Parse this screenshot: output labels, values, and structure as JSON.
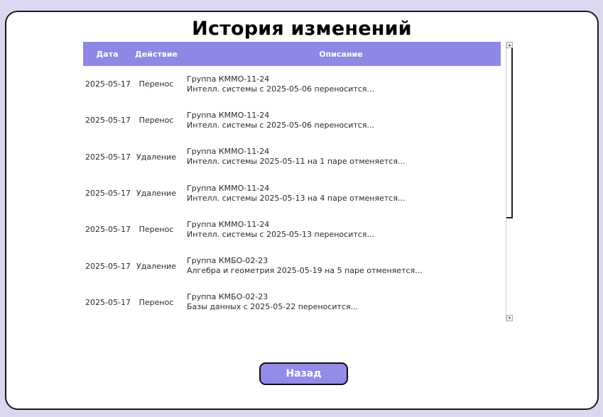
{
  "page": {
    "title": "История изменений"
  },
  "table": {
    "columns": [
      "Дата",
      "Действие",
      "Описание"
    ],
    "rows": [
      {
        "date": "2025-05-17",
        "action": "Перенос",
        "line1": "Группа КММО-11-24",
        "line2": "Интелл. системы с 2025-05-06 переносится..."
      },
      {
        "date": "2025-05-17",
        "action": "Перенос",
        "line1": "Группа КММО-11-24",
        "line2": "Интелл. системы с 2025-05-06 переносится..."
      },
      {
        "date": "2025-05-17",
        "action": "Удаление",
        "line1": "Группа КММО-11-24",
        "line2": "Интелл. системы 2025-05-11 на 1 паре отменяется..."
      },
      {
        "date": "2025-05-17",
        "action": "Удаление",
        "line1": "Группа КММО-11-24",
        "line2": "Интелл. системы 2025-05-13 на 4 паре отменяется..."
      },
      {
        "date": "2025-05-17",
        "action": "Перенос",
        "line1": "Группа КММО-11-24",
        "line2": "Интелл. системы с 2025-05-13 переносится..."
      },
      {
        "date": "2025-05-17",
        "action": "Удаление",
        "line1": "Группа КМБО-02-23",
        "line2": "Алгебра и геометрия 2025-05-19 на 5 паре отменяется..."
      },
      {
        "date": "2025-05-17",
        "action": "Перенос",
        "line1": "Группа КМБО-02-23",
        "line2": "Базы данных с 2025-05-22 переносится..."
      }
    ]
  },
  "scrollbar": {
    "up_icon": "▴",
    "down_icon": "▾"
  },
  "buttons": {
    "back_label": "Назад"
  },
  "colors": {
    "header_bg": "#8f87e6",
    "button_bg": "#938ce6",
    "page_bg": "#dcd7ef"
  }
}
